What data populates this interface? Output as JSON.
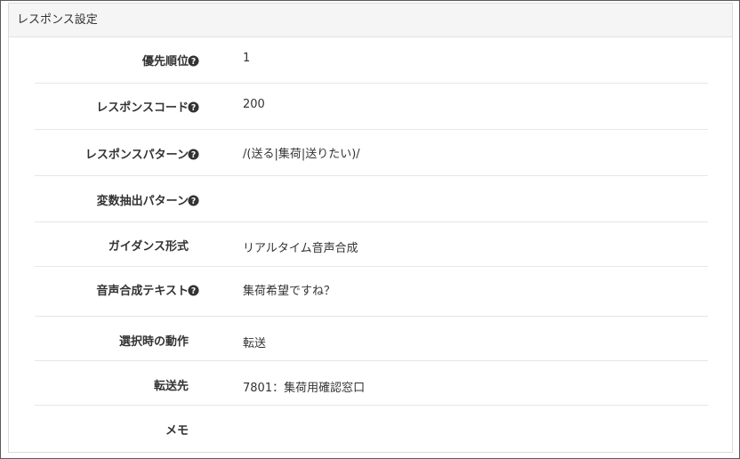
{
  "panel": {
    "title": "レスポンス設定"
  },
  "rows": [
    {
      "label": "優先順位",
      "help": true,
      "value": "1"
    },
    {
      "label": "レスポンスコード",
      "help": true,
      "value": "200"
    },
    {
      "label": "レスポンスパターン",
      "help": true,
      "value": "/(送る|集荷|送りたい)/"
    },
    {
      "label": "変数抽出パターン",
      "help": true,
      "value": ""
    },
    {
      "label": "ガイダンス形式",
      "help": false,
      "value": "リアルタイム音声合成"
    },
    {
      "label": "音声合成テキスト",
      "help": true,
      "value": "集荷希望ですね？"
    },
    {
      "label": "選択時の動作",
      "help": false,
      "value": "転送"
    },
    {
      "label": "転送先",
      "help": false,
      "value": "7801：集荷用確認窓口"
    },
    {
      "label": "メモ",
      "help": false,
      "value": ""
    }
  ],
  "icons": {
    "help": "question-circle-icon"
  },
  "colors": {
    "header_bg": "#f5f5f5",
    "icon": "#333333",
    "divider": "#e6e6e6"
  }
}
